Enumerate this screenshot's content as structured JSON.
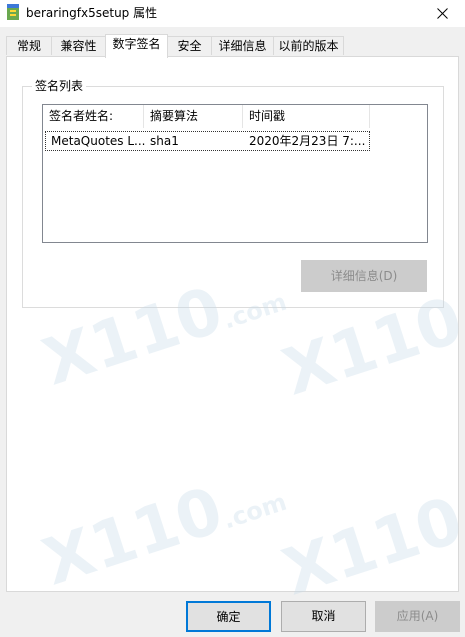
{
  "window": {
    "title": "beraringfx5setup 属性"
  },
  "tabs": [
    {
      "label": "常规"
    },
    {
      "label": "兼容性"
    },
    {
      "label": "数字签名"
    },
    {
      "label": "安全"
    },
    {
      "label": "详细信息"
    },
    {
      "label": "以前的版本"
    }
  ],
  "active_tab": "数字签名",
  "signature_list": {
    "group_label": "签名列表",
    "columns": [
      {
        "label": "签名者姓名:"
      },
      {
        "label": "摘要算法"
      },
      {
        "label": "时间戳"
      }
    ],
    "rows": [
      {
        "signer": "MetaQuotes L...",
        "algorithm": "sha1",
        "timestamp": "2020年2月23日 7:..."
      }
    ],
    "details_button": "详细信息(D)"
  },
  "watermark": {
    "number": "X110",
    "suffix": ".com"
  },
  "footer": {
    "ok": "确定",
    "cancel": "取消",
    "apply": "应用(A)"
  },
  "colors": {
    "accent": "#0078d7",
    "disabled_bg": "#cccccc",
    "disabled_text": "#8c8c8c"
  }
}
